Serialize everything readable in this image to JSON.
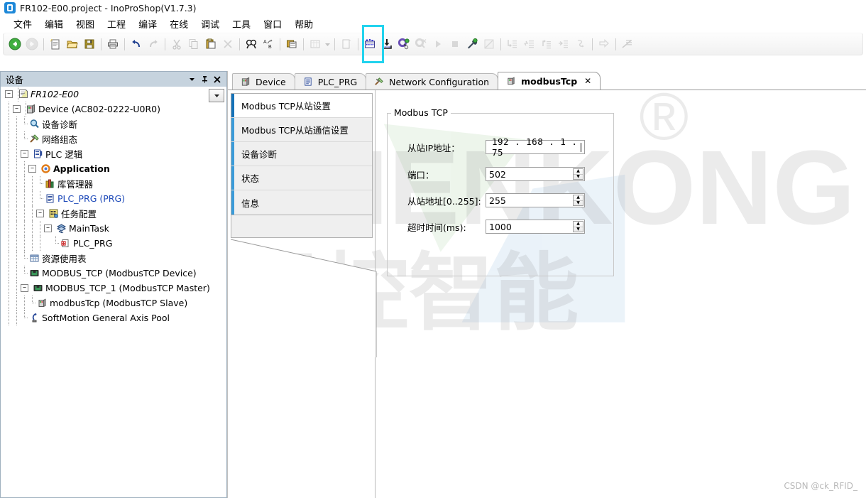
{
  "window": {
    "title": "FR102-E00.project - InoProShop(V1.7.3)",
    "app_icon": "app-icon"
  },
  "menu": {
    "items": [
      {
        "label": "文件"
      },
      {
        "label": "编辑"
      },
      {
        "label": "视图"
      },
      {
        "label": "工程"
      },
      {
        "label": "编译"
      },
      {
        "label": "在线"
      },
      {
        "label": "调试"
      },
      {
        "label": "工具"
      },
      {
        "label": "窗口"
      },
      {
        "label": "帮助"
      }
    ]
  },
  "toolbar": {
    "highlighted_button": "login-connect-button",
    "highlight_color": "#22d3ee",
    "buttons": [
      {
        "name": "back-button",
        "enabled": true
      },
      {
        "name": "forward-button",
        "enabled": false
      },
      {
        "name": "new-project-button",
        "enabled": true
      },
      {
        "name": "open-project-button",
        "enabled": true
      },
      {
        "name": "save-project-button",
        "enabled": true
      },
      {
        "name": "print-button",
        "enabled": true
      },
      {
        "name": "undo-button",
        "enabled": true
      },
      {
        "name": "redo-button",
        "enabled": false
      },
      {
        "name": "cut-button",
        "enabled": false
      },
      {
        "name": "copy-button",
        "enabled": false
      },
      {
        "name": "paste-button",
        "enabled": true
      },
      {
        "name": "delete-button",
        "enabled": false
      },
      {
        "name": "find-button",
        "enabled": true
      },
      {
        "name": "replace-button",
        "enabled": true
      },
      {
        "name": "properties-button",
        "enabled": true
      },
      {
        "name": "grid-button",
        "enabled": false
      },
      {
        "name": "grid-dropdown-button",
        "enabled": false
      },
      {
        "name": "new-object-button",
        "enabled": false
      },
      {
        "name": "compile-button",
        "enabled": true
      },
      {
        "name": "download-button",
        "enabled": true
      },
      {
        "name": "login-connect-button",
        "enabled": true
      },
      {
        "name": "logout-button",
        "enabled": false
      },
      {
        "name": "run-button",
        "enabled": false
      },
      {
        "name": "stop-button",
        "enabled": false
      },
      {
        "name": "build-config-button",
        "enabled": true
      },
      {
        "name": "edit-mode-button",
        "enabled": false
      },
      {
        "name": "step-into-button",
        "enabled": false
      },
      {
        "name": "step-over-button",
        "enabled": false
      },
      {
        "name": "step-out-button",
        "enabled": false
      },
      {
        "name": "run-to-cursor-button",
        "enabled": false
      },
      {
        "name": "set-next-statement-button",
        "enabled": false
      },
      {
        "name": "next-statement-button",
        "enabled": false
      },
      {
        "name": "breakpoint-toggle-button",
        "enabled": false
      }
    ]
  },
  "devices_panel": {
    "title": "设备",
    "header_buttons": [
      {
        "name": "panel-menu-button",
        "glyph": "▼"
      },
      {
        "name": "panel-pin-button",
        "glyph": "⚲"
      },
      {
        "name": "panel-close-button",
        "glyph": "✕"
      }
    ],
    "tree_dropdown_glyph": "▼",
    "tree": [
      {
        "label": "FR102-E00",
        "icon": "project-icon",
        "depth": 0,
        "expander": "-",
        "style": "italic"
      },
      {
        "label": "Device (AC802-0222-U0R0)",
        "icon": "plc-device-icon",
        "depth": 1,
        "expander": "-",
        "style": "normal"
      },
      {
        "label": "设备诊断",
        "icon": "magnifier-icon",
        "depth": 2,
        "expander": "",
        "style": "normal"
      },
      {
        "label": "网络组态",
        "icon": "network-config-icon",
        "depth": 2,
        "expander": "",
        "style": "normal"
      },
      {
        "label": "PLC 逻辑",
        "icon": "plc-logic-icon",
        "depth": 2,
        "expander": "-",
        "style": "normal"
      },
      {
        "label": "Application",
        "icon": "application-icon",
        "depth": 3,
        "expander": "-",
        "style": "bold"
      },
      {
        "label": "库管理器",
        "icon": "library-manager-icon",
        "depth": 4,
        "expander": "",
        "style": "normal"
      },
      {
        "label": "PLC_PRG (PRG)",
        "icon": "pou-icon",
        "depth": 4,
        "expander": "",
        "style": "link"
      },
      {
        "label": "任务配置",
        "icon": "task-config-icon",
        "depth": 4,
        "expander": "-",
        "style": "normal"
      },
      {
        "label": "MainTask",
        "icon": "task-icon",
        "depth": 5,
        "expander": "-",
        "style": "normal"
      },
      {
        "label": "PLC_PRG",
        "icon": "task-call-icon",
        "depth": 6,
        "expander": "",
        "style": "normal"
      },
      {
        "label": "资源使用表",
        "icon": "resource-table-icon",
        "depth": 2,
        "expander": "",
        "style": "normal"
      },
      {
        "label": "MODBUS_TCP (ModbusTCP Device)",
        "icon": "ethernet-icon",
        "depth": 2,
        "expander": "",
        "style": "normal"
      },
      {
        "label": "MODBUS_TCP_1 (ModbusTCP Master)",
        "icon": "ethernet-icon",
        "depth": 2,
        "expander": "-",
        "style": "normal"
      },
      {
        "label": "modbusTcp (ModbusTCP Slave)",
        "icon": "slave-device-icon",
        "depth": 3,
        "expander": "",
        "style": "normal"
      },
      {
        "label": "SoftMotion General Axis Pool",
        "icon": "axis-pool-icon",
        "depth": 2,
        "expander": "",
        "style": "normal"
      }
    ]
  },
  "editor": {
    "tabs": [
      {
        "label": "Device",
        "icon": "plc-device-icon",
        "active": false,
        "closable": false
      },
      {
        "label": "PLC_PRG",
        "icon": "pou-icon",
        "active": false,
        "closable": false
      },
      {
        "label": "Network Configuration",
        "icon": "network-config-icon",
        "active": false,
        "closable": false
      },
      {
        "label": "modbusTcp",
        "icon": "slave-device-icon",
        "active": true,
        "closable": true,
        "close_glyph": "✕"
      }
    ],
    "side_tabs": [
      {
        "label": "Modbus TCP从站设置",
        "active": true
      },
      {
        "label": "Modbus TCP从站通信设置",
        "active": false
      },
      {
        "label": "设备诊断",
        "active": false
      },
      {
        "label": "状态",
        "active": false
      },
      {
        "label": "信息",
        "active": false
      }
    ],
    "group": {
      "title": "Modbus TCP",
      "fields": [
        {
          "name": "slave-ip-address",
          "label": "从站IP地址：",
          "type": "ip",
          "value": "192 . 168 .  1  .  75",
          "focused": true
        },
        {
          "name": "port",
          "label": "端口：",
          "type": "spinner",
          "value": "502",
          "focused": false
        },
        {
          "name": "slave-address",
          "label": "从站地址[0..255]:",
          "type": "spinner",
          "value": "255",
          "focused": false
        },
        {
          "name": "response-timeout",
          "label": "超时时间(ms):",
          "type": "spinner",
          "value": "1000",
          "focused": false
        }
      ],
      "spinner_up_glyph": "▲",
      "spinner_down_glyph": "▼"
    }
  },
  "watermark": {
    "brand_text": "CHENKONG",
    "brand_cn": "晨控智能",
    "registered_mark": "®",
    "credit": "CSDN @ck_RFID_"
  },
  "colors": {
    "accent_blue": "#3a9bd9",
    "highlight_cyan": "#22d3ee",
    "panel_header": "#c6d3de",
    "link": "#1c48b8"
  }
}
